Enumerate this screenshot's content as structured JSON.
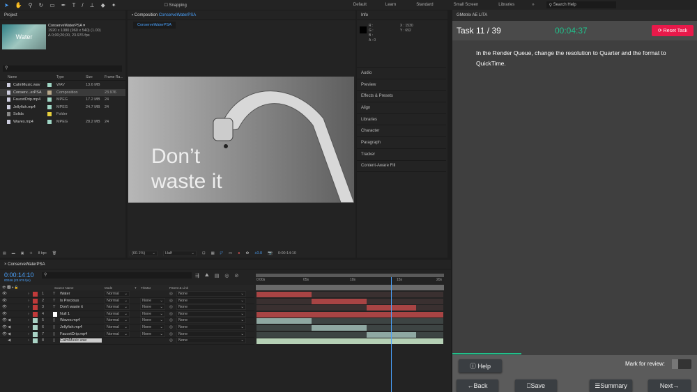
{
  "toolbar": {
    "snapping": "Snapping",
    "workspaces": [
      "Default",
      "Learn",
      "Standard",
      "Small Screen",
      "Libraries"
    ],
    "more": "»",
    "search_placeholder": "Search Help"
  },
  "project": {
    "title": "Project",
    "comp_name": "ConserveWaterPSA ▾",
    "comp_size": "1920 x 1080  (960 x 540) (1.00)",
    "comp_duration": "Δ 0;00;20;00, 23.976 fps",
    "thumb_text": "Water",
    "columns": [
      "Name",
      "Type",
      "Size",
      "Frame Ra..."
    ],
    "items": [
      {
        "name": "CalmMusic.wav",
        "type": "WAV",
        "size": "13.6 MB",
        "fps": "",
        "color": "#9fd6c5",
        "icon": "audio-file"
      },
      {
        "name": "Conserv...erPSA",
        "type": "Composition",
        "size": "",
        "fps": "23.976",
        "color": "#b8a88a",
        "icon": "composition"
      },
      {
        "name": "FaucetDrip.mp4",
        "type": "MPEG",
        "size": "17.2 MB",
        "fps": "24",
        "color": "#9fd6c5",
        "icon": "video-file"
      },
      {
        "name": "Jellyfish.mp4",
        "type": "MPEG",
        "size": "24.7 MB",
        "fps": "24",
        "color": "#9fd6c5",
        "icon": "video-file"
      },
      {
        "name": "Solids",
        "type": "Folder",
        "size": "",
        "fps": "",
        "color": "#e6cf3c",
        "icon": "folder"
      },
      {
        "name": "Waves.mp4",
        "type": "MPEG",
        "size": "28.2 MB",
        "fps": "24",
        "color": "#9fd6c5",
        "icon": "video-file"
      }
    ],
    "bpc": "8 bpc"
  },
  "comp": {
    "title_prefix": "Composition",
    "title_name": "ConserveWaterPSA",
    "tab": "ConserveWaterPSA",
    "overlay_line1": "Don’t",
    "overlay_line2": "waste it",
    "zoom": "(60.1%)",
    "resolution": "Half",
    "exposure": "+0.0",
    "timecode": "0:00:14:10"
  },
  "info": {
    "title": "Info",
    "r": "R :",
    "g": "G :",
    "b": "B :",
    "a": "A :  0",
    "x": "X : 1530",
    "y": "Y : 652",
    "panels": [
      "Audio",
      "Preview",
      "Effects & Presets",
      "Align",
      "Libraries",
      "Character",
      "Paragraph",
      "Tracker",
      "Content-Aware Fill"
    ]
  },
  "timeline": {
    "tab": "ConserveWaterPSA",
    "timecode": "0:00:14:10",
    "frames": "00346 (23.976 fps)",
    "columns": [
      "Source Name",
      "Mode",
      "T",
      "TrkMat",
      "Parent & Link"
    ],
    "ruler": [
      "0:00s",
      "05s",
      "10s",
      "15s",
      "20s"
    ],
    "playhead_seconds": 14.4,
    "duration_seconds": 20,
    "layers": [
      {
        "num": "1",
        "name": "Water",
        "kind": "T",
        "mode": "Normal",
        "trkmat": "",
        "parent": "None",
        "color": "#c03a3a",
        "audio": false,
        "bar": [
          0,
          5.9
        ],
        "bar_color": "#a84444"
      },
      {
        "num": "2",
        "name": "Is Precious",
        "kind": "T",
        "mode": "Normal",
        "trkmat": "None",
        "parent": "None",
        "color": "#c03a3a",
        "audio": false,
        "bar": [
          5.9,
          11.8
        ],
        "bar_color": "#a84444"
      },
      {
        "num": "3",
        "name": "Don't waste it",
        "kind": "T",
        "mode": "Normal",
        "trkmat": "None",
        "parent": "None",
        "color": "#c03a3a",
        "audio": false,
        "bar": [
          11.8,
          17.1
        ],
        "bar_color": "#a84444"
      },
      {
        "num": "4",
        "name": "Null 1",
        "kind": "null",
        "mode": "Normal",
        "trkmat": "None",
        "parent": "None",
        "color": "#c03a3a",
        "audio": false,
        "bar": [
          0,
          20
        ],
        "bar_color": "#a84444"
      },
      {
        "num": "5",
        "name": "Waves.mp4",
        "kind": "video",
        "mode": "Normal",
        "trkmat": "None",
        "parent": "None",
        "color": "#a9d3c5",
        "audio": true,
        "bar": [
          0,
          5.9
        ],
        "bar_color": "#8fa8a2"
      },
      {
        "num": "6",
        "name": "Jellyfish.mp4",
        "kind": "video",
        "mode": "Normal",
        "trkmat": "None",
        "parent": "None",
        "color": "#a9d3c5",
        "audio": true,
        "bar": [
          5.9,
          11.8
        ],
        "bar_color": "#8fa8a2"
      },
      {
        "num": "7",
        "name": "FaucetDrip.mp4",
        "kind": "video",
        "mode": "Normal",
        "trkmat": "None",
        "parent": "None",
        "color": "#a9d3c5",
        "audio": true,
        "bar": [
          11.8,
          17.1
        ],
        "bar_color": "#8fa8a2"
      },
      {
        "num": "8",
        "name": "CalmMusic.wav",
        "kind": "audio",
        "mode": "",
        "trkmat": "",
        "parent": "None",
        "color": "#a9d3c5",
        "audio": true,
        "bar": [
          0,
          20
        ],
        "bar_color": "#b5d0b5"
      }
    ]
  },
  "gmetrix": {
    "title": "GMetrix AE LITA",
    "task": "Task 11 / 39",
    "timer": "00:04:37",
    "reset": "Reset Task",
    "instruction": "In the Render Queue, change the resolution to Quarter and the format to QuickTime.",
    "progress": 0.282,
    "help": "Help",
    "mark_review": "Mark for review:",
    "back": "Back",
    "save": "Save",
    "summary": "Summary",
    "next": "Next",
    "accent": "#21c08b",
    "reset_color": "#e8194a"
  }
}
